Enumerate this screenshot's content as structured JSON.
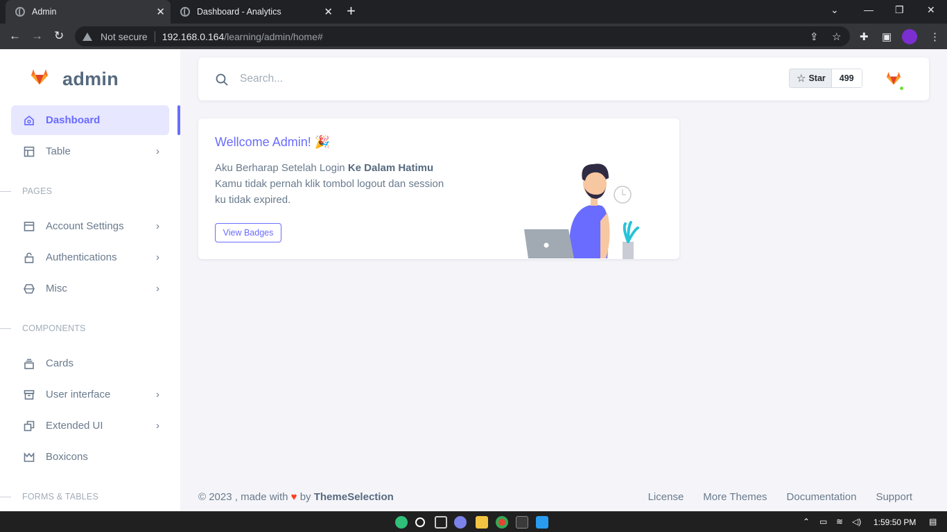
{
  "browser": {
    "tabs": [
      {
        "title": "Admin",
        "active": true
      },
      {
        "title": "Dashboard - Analytics",
        "active": false
      }
    ],
    "address": {
      "security": "Not secure",
      "host": "192.168.0.164",
      "path": "/learning/admin/home#"
    }
  },
  "sidebar": {
    "brand": "admin",
    "items_top": [
      {
        "label": "Dashboard",
        "icon": "home-icon",
        "active": true
      },
      {
        "label": "Table",
        "icon": "layout-icon",
        "chevron": true
      }
    ],
    "sections": [
      {
        "label": "PAGES",
        "items": [
          {
            "label": "Account Settings",
            "icon": "dock-icon",
            "chevron": true
          },
          {
            "label": "Authentications",
            "icon": "lock-icon",
            "chevron": true
          },
          {
            "label": "Misc",
            "icon": "cube-icon",
            "chevron": true
          }
        ]
      },
      {
        "label": "COMPONENTS",
        "items": [
          {
            "label": "Cards",
            "icon": "collection-icon",
            "chevron": false
          },
          {
            "label": "User interface",
            "icon": "box-icon",
            "chevron": true
          },
          {
            "label": "Extended UI",
            "icon": "copy-icon",
            "chevron": true
          },
          {
            "label": "Boxicons",
            "icon": "crown-icon",
            "chevron": false
          }
        ]
      },
      {
        "label": "FORMS & TABLES",
        "items": []
      }
    ]
  },
  "navbar": {
    "search_placeholder": "Search...",
    "star_label": "Star",
    "star_count": "499"
  },
  "welcome_card": {
    "title": "Wellcome Admin! 🎉",
    "line1_plain": "Aku Berharap Setelah Login ",
    "line1_bold": "Ke Dalam Hatimu",
    "line2": "Kamu tidak pernah klik tombol logout dan session ku tidak expired.",
    "button": "View Badges"
  },
  "footer": {
    "copyright": "© 2023 , made with",
    "by": "by",
    "author": "ThemeSelection",
    "links": [
      "License",
      "More Themes",
      "Documentation",
      "Support"
    ]
  },
  "taskbar": {
    "time": "1:59:50 PM"
  },
  "colors": {
    "accent": "#696cff",
    "text": "#697a8d",
    "heading": "#566a7f",
    "online": "#71dd37",
    "heart": "#ff3e1d"
  }
}
